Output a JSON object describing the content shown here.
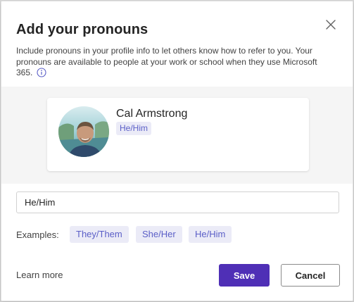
{
  "dialog": {
    "title": "Add your pronouns",
    "description": "Include pronouns in your profile info to let others know how to refer to you. Your pronouns are available to people at your work or school when they use Microsoft 365.",
    "close_icon": "close-icon",
    "info_icon": "info-icon"
  },
  "profile_card": {
    "name": "Cal Armstrong",
    "pronoun_badge": "He/Him",
    "avatar_icon": "avatar"
  },
  "pronoun_input": {
    "value": "He/Him",
    "placeholder": ""
  },
  "examples": {
    "label": "Examples:",
    "chips": [
      "They/Them",
      "She/Her",
      "He/Him"
    ]
  },
  "footer": {
    "learn_more": "Learn more",
    "save_label": "Save",
    "cancel_label": "Cancel"
  },
  "colors": {
    "accent": "#4f2fb6",
    "chip_bg": "#ebebf7",
    "chip_text": "#5b5fc7"
  }
}
